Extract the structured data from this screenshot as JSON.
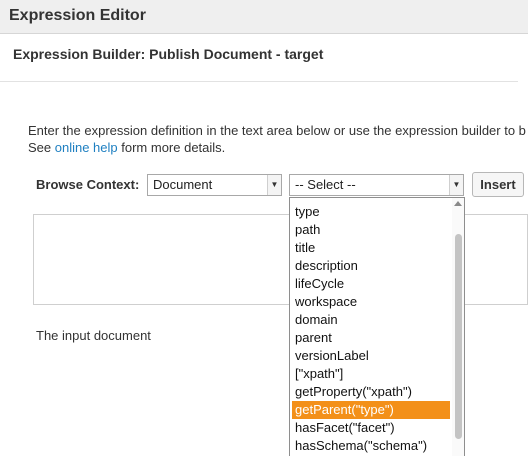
{
  "window": {
    "title": "Expression Editor"
  },
  "builder": {
    "heading": "Expression Builder: Publish Document - target",
    "help_line1": "Enter the expression definition in the text area below or use the expression builder to b",
    "help_line2_prefix": "See ",
    "help_link": "online help",
    "help_line2_suffix": " form more details.",
    "browse_label": "Browse Context:",
    "document_select_value": "Document",
    "context_select_value": "-- Select --",
    "insert_label": "Insert",
    "description": "The input document"
  },
  "dropdown": {
    "options": [
      "type",
      "path",
      "title",
      "description",
      "lifeCycle",
      "workspace",
      "domain",
      "parent",
      "versionLabel",
      "[\"xpath\"]",
      "getProperty(\"xpath\")",
      "getParent(\"type\")",
      "hasFacet(\"facet\")",
      "hasSchema(\"schema\")"
    ],
    "selected_index": 11
  },
  "colors": {
    "highlight": "#f39019",
    "link": "#1e7fc1"
  }
}
